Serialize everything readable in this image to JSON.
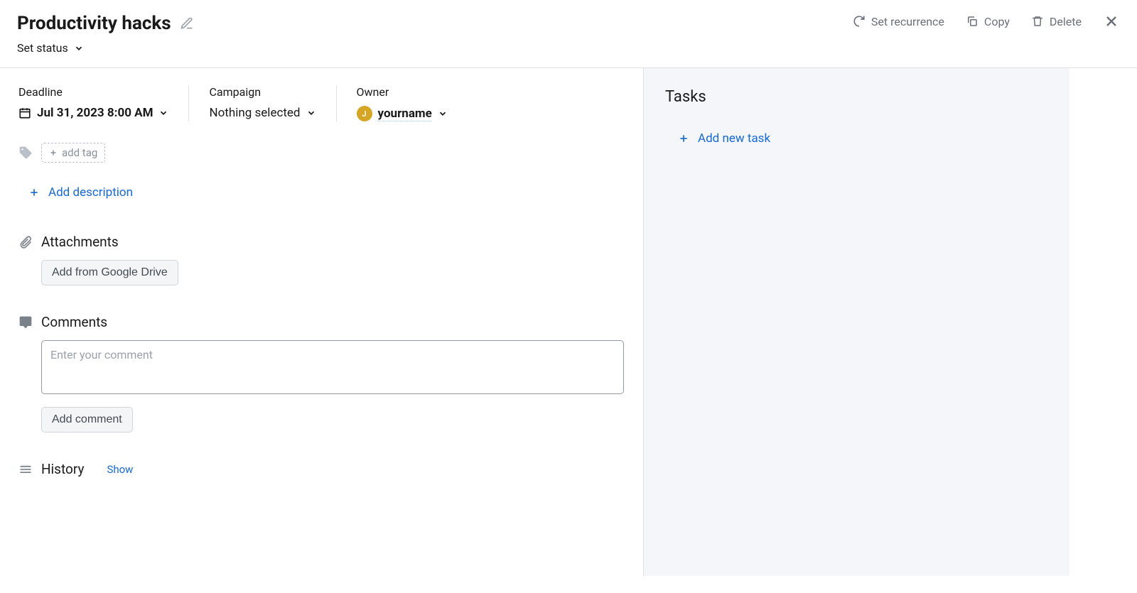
{
  "header": {
    "title": "Productivity hacks",
    "actions": {
      "recurrence": "Set recurrence",
      "copy": "Copy",
      "delete": "Delete"
    },
    "status_label": "Set status"
  },
  "fields": {
    "deadline": {
      "label": "Deadline",
      "value": "Jul 31, 2023 8:00 AM"
    },
    "campaign": {
      "label": "Campaign",
      "value": "Nothing selected"
    },
    "owner": {
      "label": "Owner",
      "initial": "J",
      "name": "yourname"
    }
  },
  "tags": {
    "add_label": "add tag"
  },
  "description": {
    "add_label": "Add description"
  },
  "attachments": {
    "title": "Attachments",
    "button": "Add from Google Drive"
  },
  "comments": {
    "title": "Comments",
    "placeholder": "Enter your comment",
    "button": "Add comment"
  },
  "history": {
    "title": "History",
    "show": "Show"
  },
  "tasks": {
    "title": "Tasks",
    "add": "Add new task"
  }
}
